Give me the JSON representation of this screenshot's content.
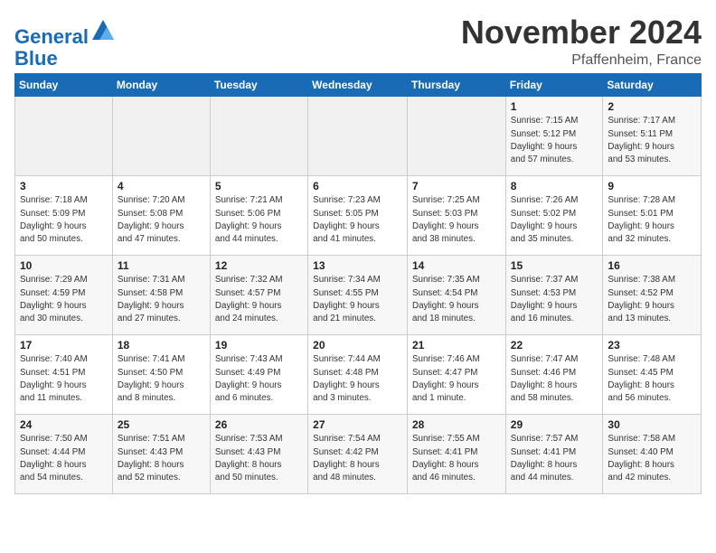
{
  "header": {
    "logo_line1": "General",
    "logo_line2": "Blue",
    "month": "November 2024",
    "location": "Pfaffenheim, France"
  },
  "weekdays": [
    "Sunday",
    "Monday",
    "Tuesday",
    "Wednesday",
    "Thursday",
    "Friday",
    "Saturday"
  ],
  "weeks": [
    [
      {
        "day": "",
        "info": ""
      },
      {
        "day": "",
        "info": ""
      },
      {
        "day": "",
        "info": ""
      },
      {
        "day": "",
        "info": ""
      },
      {
        "day": "",
        "info": ""
      },
      {
        "day": "1",
        "info": "Sunrise: 7:15 AM\nSunset: 5:12 PM\nDaylight: 9 hours\nand 57 minutes."
      },
      {
        "day": "2",
        "info": "Sunrise: 7:17 AM\nSunset: 5:11 PM\nDaylight: 9 hours\nand 53 minutes."
      }
    ],
    [
      {
        "day": "3",
        "info": "Sunrise: 7:18 AM\nSunset: 5:09 PM\nDaylight: 9 hours\nand 50 minutes."
      },
      {
        "day": "4",
        "info": "Sunrise: 7:20 AM\nSunset: 5:08 PM\nDaylight: 9 hours\nand 47 minutes."
      },
      {
        "day": "5",
        "info": "Sunrise: 7:21 AM\nSunset: 5:06 PM\nDaylight: 9 hours\nand 44 minutes."
      },
      {
        "day": "6",
        "info": "Sunrise: 7:23 AM\nSunset: 5:05 PM\nDaylight: 9 hours\nand 41 minutes."
      },
      {
        "day": "7",
        "info": "Sunrise: 7:25 AM\nSunset: 5:03 PM\nDaylight: 9 hours\nand 38 minutes."
      },
      {
        "day": "8",
        "info": "Sunrise: 7:26 AM\nSunset: 5:02 PM\nDaylight: 9 hours\nand 35 minutes."
      },
      {
        "day": "9",
        "info": "Sunrise: 7:28 AM\nSunset: 5:01 PM\nDaylight: 9 hours\nand 32 minutes."
      }
    ],
    [
      {
        "day": "10",
        "info": "Sunrise: 7:29 AM\nSunset: 4:59 PM\nDaylight: 9 hours\nand 30 minutes."
      },
      {
        "day": "11",
        "info": "Sunrise: 7:31 AM\nSunset: 4:58 PM\nDaylight: 9 hours\nand 27 minutes."
      },
      {
        "day": "12",
        "info": "Sunrise: 7:32 AM\nSunset: 4:57 PM\nDaylight: 9 hours\nand 24 minutes."
      },
      {
        "day": "13",
        "info": "Sunrise: 7:34 AM\nSunset: 4:55 PM\nDaylight: 9 hours\nand 21 minutes."
      },
      {
        "day": "14",
        "info": "Sunrise: 7:35 AM\nSunset: 4:54 PM\nDaylight: 9 hours\nand 18 minutes."
      },
      {
        "day": "15",
        "info": "Sunrise: 7:37 AM\nSunset: 4:53 PM\nDaylight: 9 hours\nand 16 minutes."
      },
      {
        "day": "16",
        "info": "Sunrise: 7:38 AM\nSunset: 4:52 PM\nDaylight: 9 hours\nand 13 minutes."
      }
    ],
    [
      {
        "day": "17",
        "info": "Sunrise: 7:40 AM\nSunset: 4:51 PM\nDaylight: 9 hours\nand 11 minutes."
      },
      {
        "day": "18",
        "info": "Sunrise: 7:41 AM\nSunset: 4:50 PM\nDaylight: 9 hours\nand 8 minutes."
      },
      {
        "day": "19",
        "info": "Sunrise: 7:43 AM\nSunset: 4:49 PM\nDaylight: 9 hours\nand 6 minutes."
      },
      {
        "day": "20",
        "info": "Sunrise: 7:44 AM\nSunset: 4:48 PM\nDaylight: 9 hours\nand 3 minutes."
      },
      {
        "day": "21",
        "info": "Sunrise: 7:46 AM\nSunset: 4:47 PM\nDaylight: 9 hours\nand 1 minute."
      },
      {
        "day": "22",
        "info": "Sunrise: 7:47 AM\nSunset: 4:46 PM\nDaylight: 8 hours\nand 58 minutes."
      },
      {
        "day": "23",
        "info": "Sunrise: 7:48 AM\nSunset: 4:45 PM\nDaylight: 8 hours\nand 56 minutes."
      }
    ],
    [
      {
        "day": "24",
        "info": "Sunrise: 7:50 AM\nSunset: 4:44 PM\nDaylight: 8 hours\nand 54 minutes."
      },
      {
        "day": "25",
        "info": "Sunrise: 7:51 AM\nSunset: 4:43 PM\nDaylight: 8 hours\nand 52 minutes."
      },
      {
        "day": "26",
        "info": "Sunrise: 7:53 AM\nSunset: 4:43 PM\nDaylight: 8 hours\nand 50 minutes."
      },
      {
        "day": "27",
        "info": "Sunrise: 7:54 AM\nSunset: 4:42 PM\nDaylight: 8 hours\nand 48 minutes."
      },
      {
        "day": "28",
        "info": "Sunrise: 7:55 AM\nSunset: 4:41 PM\nDaylight: 8 hours\nand 46 minutes."
      },
      {
        "day": "29",
        "info": "Sunrise: 7:57 AM\nSunset: 4:41 PM\nDaylight: 8 hours\nand 44 minutes."
      },
      {
        "day": "30",
        "info": "Sunrise: 7:58 AM\nSunset: 4:40 PM\nDaylight: 8 hours\nand 42 minutes."
      }
    ]
  ]
}
